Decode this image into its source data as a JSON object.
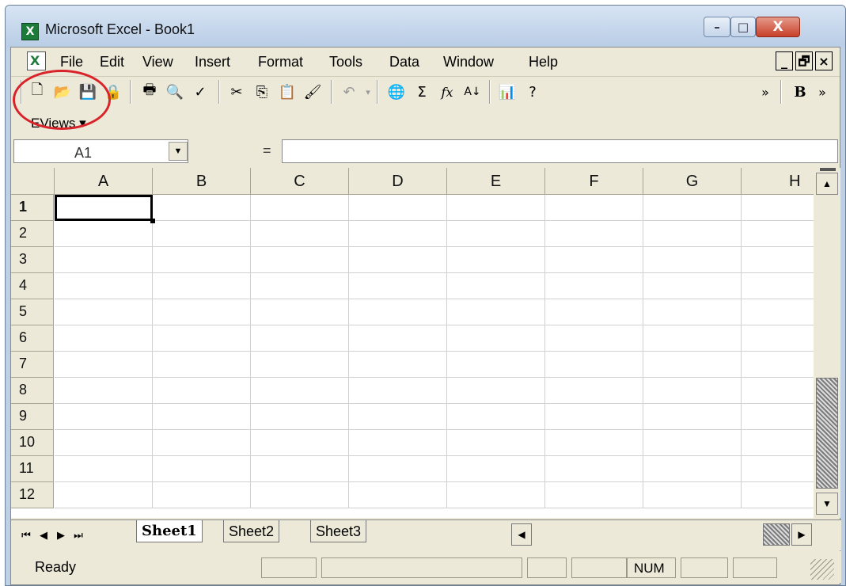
{
  "caption_text": "",
  "window": {
    "title": "Microsoft Excel - Book1",
    "min_glyph": "–",
    "max_glyph": "□",
    "close_glyph": "X"
  },
  "menubar": {
    "items": [
      "File",
      "Edit",
      "View",
      "Insert",
      "Format",
      "Tools",
      "Data",
      "Window",
      "Help"
    ],
    "doc_min": "_",
    "doc_restore": "🗗",
    "doc_close": "×"
  },
  "toolbar": {
    "buttons": [
      "new-document",
      "open",
      "save",
      "permission",
      "print",
      "print-preview",
      "spelling",
      "cut",
      "copy",
      "paste",
      "format-painter",
      "undo",
      "hyperlink",
      "autosum",
      "function",
      "sort-ascending",
      "chart-wizard",
      "help"
    ],
    "overflow": "»",
    "bold": "B",
    "overflow2": "»"
  },
  "eviews_menu": "EViews ▾",
  "formula_bar": {
    "namebox_value": "A1",
    "equals": "=",
    "formula_value": ""
  },
  "columns": [
    "A",
    "B",
    "C",
    "D",
    "E",
    "F",
    "G",
    "H"
  ],
  "rows": [
    "1",
    "2",
    "3",
    "4",
    "5",
    "6",
    "7",
    "8",
    "9",
    "10",
    "11",
    "12"
  ],
  "tabs": {
    "sheets": [
      "Sheet1",
      "Sheet2",
      "Sheet3"
    ],
    "active_index": 0
  },
  "statusbar": {
    "status": "Ready",
    "num": "NUM"
  },
  "colors": {
    "excel_green": "#1d7b3a",
    "highlight_red": "#d9232a"
  }
}
